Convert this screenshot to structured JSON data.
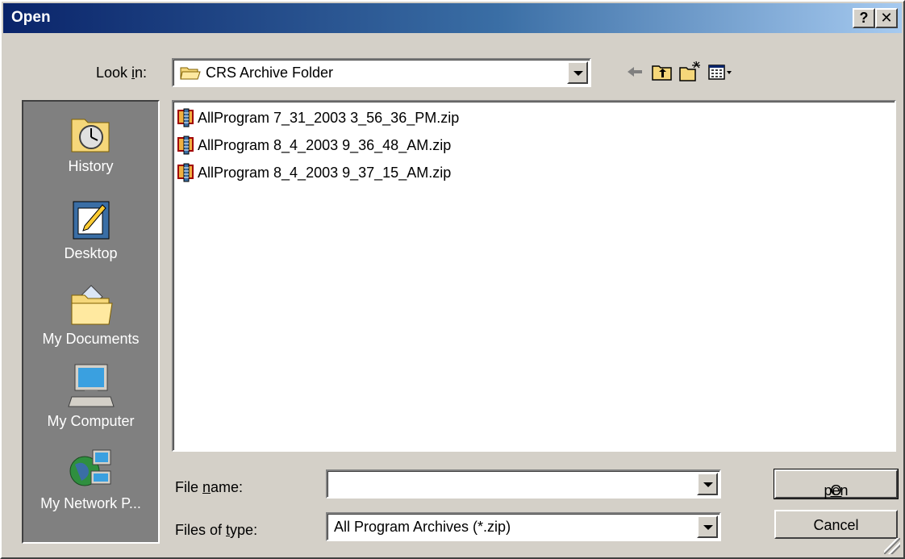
{
  "window": {
    "title": "Open",
    "help_glyph": "?",
    "close_glyph": "✕"
  },
  "lookin": {
    "label_pre": "Look ",
    "label_key": "i",
    "label_post": "n:",
    "value": "CRS Archive Folder"
  },
  "toolbar": {
    "icons": [
      "back-arrow-icon",
      "up-folder-icon",
      "new-folder-icon",
      "view-menu-icon"
    ]
  },
  "places": [
    {
      "label": "History",
      "icon": "history-clock-icon"
    },
    {
      "label": "Desktop",
      "icon": "desktop-icon"
    },
    {
      "label": "My Documents",
      "icon": "my-documents-folder-icon"
    },
    {
      "label": "My Computer",
      "icon": "my-computer-icon"
    },
    {
      "label": "My Network P...",
      "icon": "network-places-icon"
    }
  ],
  "files": [
    {
      "name": "AllProgram 7_31_2003 3_56_36_PM.zip",
      "icon": "zip-archive-icon"
    },
    {
      "name": "AllProgram 8_4_2003 9_36_48_AM.zip",
      "icon": "zip-archive-icon"
    },
    {
      "name": "AllProgram 8_4_2003 9_37_15_AM.zip",
      "icon": "zip-archive-icon"
    }
  ],
  "filename": {
    "label_pre": "File ",
    "label_key": "n",
    "label_post": "ame:",
    "value": ""
  },
  "filetype": {
    "label_pre": "Files of ",
    "label_key": "t",
    "label_post": "ype:",
    "value": "All Program Archives (*.zip)"
  },
  "buttons": {
    "open_key": "O",
    "open_rest": "pen",
    "cancel": "Cancel"
  },
  "colors": {
    "face": "#d4d0c8",
    "title_start": "#0a246a",
    "title_end": "#a6caf0",
    "places_bg": "#808080"
  }
}
